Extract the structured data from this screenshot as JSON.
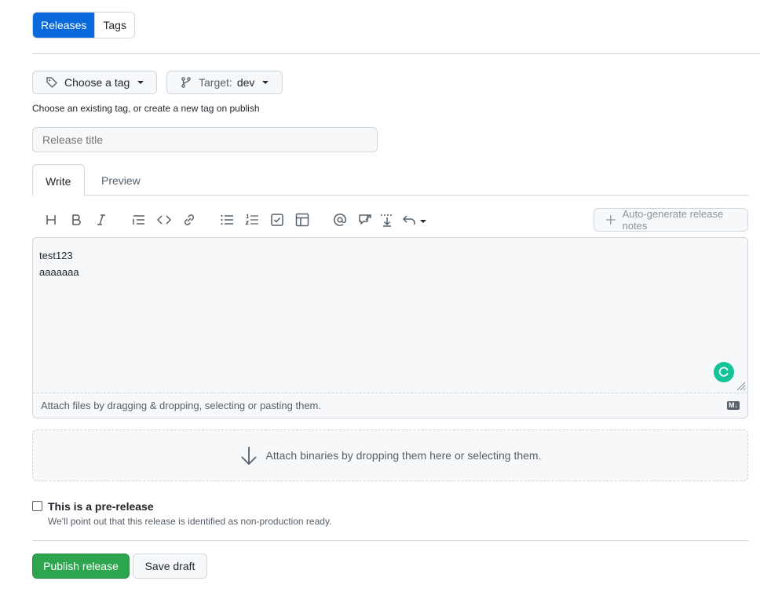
{
  "top_tabs": {
    "releases": "Releases",
    "tags": "Tags"
  },
  "tag_picker": {
    "label": "Choose a tag"
  },
  "target_picker": {
    "label": "Target:",
    "value": "dev"
  },
  "tag_hint": "Choose an existing tag, or create a new tag on publish",
  "release_title": {
    "placeholder": "Release title",
    "value": ""
  },
  "editor_tabs": {
    "write": "Write",
    "preview": "Preview"
  },
  "toolbar": {
    "icons": [
      "heading-icon",
      "bold-icon",
      "italic-icon",
      "quote-icon",
      "code-icon",
      "link-icon",
      "unordered-list-icon",
      "ordered-list-icon",
      "task-list-icon",
      "table-icon",
      "mention-icon",
      "reference-icon",
      "details-icon",
      "undo-icon"
    ],
    "auto_generate_label": "Auto-generate release notes"
  },
  "editor": {
    "lines": [
      "test123",
      "aaaaaaa"
    ],
    "attach_hint": "Attach files by dragging & dropping, selecting or pasting them.",
    "markdown_badge": "M↓"
  },
  "binaries": {
    "label": "Attach binaries by dropping them here or selecting them."
  },
  "prerelease": {
    "label": "This is a pre-release",
    "description": "We'll point out that this release is identified as non-production ready.",
    "checked": false
  },
  "actions": {
    "publish": "Publish release",
    "save_draft": "Save draft"
  },
  "colors": {
    "primary": "#0969da",
    "success": "#2da44e",
    "border": "#d0d7de",
    "grammarly": "#15c39a"
  }
}
